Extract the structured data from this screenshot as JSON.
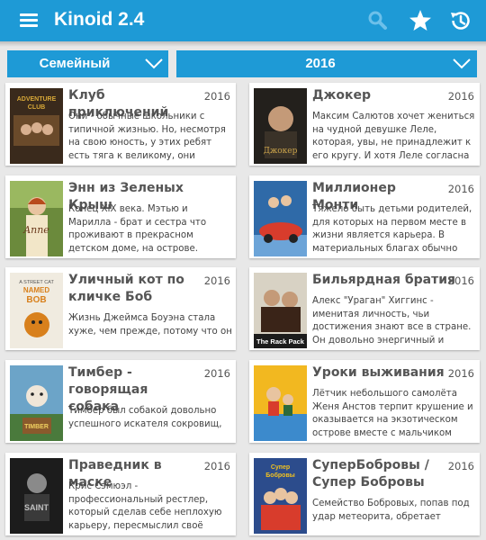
{
  "app": {
    "title": "Kinoid 2.4"
  },
  "filters": {
    "genre": "Семейный",
    "year": "2016"
  },
  "movies": [
    {
      "title": "Клуб приключений",
      "year": "2016",
      "description": "Они - обычные школьники с типичной жизнью. Но, несмотря на свою юность, у этих ребят есть тяга к великому, они мечтают о"
    },
    {
      "title": "Джокер",
      "year": "2016",
      "description": "Максим Салютов хочет жениться на чудной девушке Леле, которая, увы, не принадлежит к его кругу. И хотя Леле согласна выйти за"
    },
    {
      "title": "Энн из Зеленых Крыш",
      "year": "2016",
      "description": "Конец XIX века. Мэтью и Марилла - брат и сестра что проживают в прекрасном детском доме, на острове. Однажды их усыновили"
    },
    {
      "title": "Миллионер Монти",
      "year": "2016",
      "description": "Тяжело быть детьми родителей, для которых на первом месте в жизни является карьера. В материальных благах обычно"
    },
    {
      "title": "Уличный кот по кличке Боб",
      "year": "2016",
      "description": "Жизнь Джеймса Боуэна стала хуже, чем прежде, потому что он"
    },
    {
      "title": "Бильярдная братия",
      "year": "2016",
      "description": "Алекс \"Ураган\" Хиггинс - именитая личность, чьи достижения знают все в стране. Он довольно энергичный и эмоциональный"
    },
    {
      "title": "Тимбер - говорящая собака",
      "year": "2016",
      "description": "Тимбер был собакой довольно успешного искателя сокровищ,"
    },
    {
      "title": "Уроки выживания",
      "year": "2016",
      "description": "Лётчик небольшого самолёта Женя Анстов терпит крушение и оказывается на экзотическом острове вместе с мальчиком"
    },
    {
      "title": "Праведник в маске",
      "year": "2016",
      "description": "Крис Сэмюэл - профессиональный рестлер, который сделав себе неплохую карьеру, пересмыслил своё"
    },
    {
      "title": "СуперБобровы / Супер Бобровы",
      "year": "2016",
      "description": "Семейство Бобровых, попав под удар метеорита, обретает"
    }
  ],
  "posters": [
    {
      "name": "poster-adventure-club",
      "bg": "#3a2a1c",
      "accent": "#d8a838",
      "text": "ADVENTURE CLUB"
    },
    {
      "name": "poster-joker",
      "bg": "#23201c",
      "accent": "#c9a24a",
      "text": "Джокер"
    },
    {
      "name": "poster-anne",
      "bg": "#6b8a3c",
      "accent": "#f2e6c8",
      "text": "Anne"
    },
    {
      "name": "poster-monty",
      "bg": "#2f6aa8",
      "accent": "#d83c2c",
      "text": ""
    },
    {
      "name": "poster-bob",
      "bg": "#f0ebe0",
      "accent": "#d8801c",
      "text": "A STREET CAT NAMED BOB"
    },
    {
      "name": "poster-rack-pack",
      "bg": "#d8d2c4",
      "accent": "#3a2418",
      "text": "The Rack Pack"
    },
    {
      "name": "poster-timber",
      "bg": "#6ca4c8",
      "accent": "#8a5a2c",
      "text": "TIMBER"
    },
    {
      "name": "poster-survival",
      "bg": "#f2b820",
      "accent": "#3c8acc",
      "text": ""
    },
    {
      "name": "poster-saint",
      "bg": "#1c1c1c",
      "accent": "#c0c0c0",
      "text": "SAINT"
    },
    {
      "name": "poster-superbobrovy",
      "bg": "#2c4c8c",
      "accent": "#f0c020",
      "text": "Супер Бобровы"
    }
  ]
}
